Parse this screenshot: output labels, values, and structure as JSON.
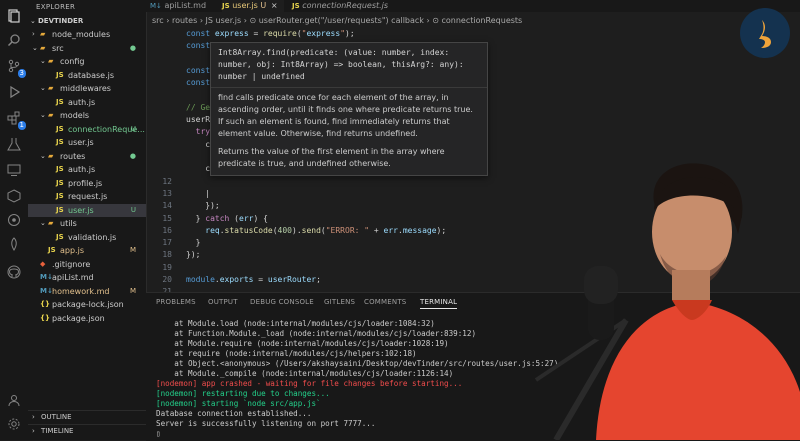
{
  "sidebar": {
    "header": "EXPLORER",
    "project": "DEVTINDER",
    "items": [
      {
        "label": "node_modules",
        "type": "folder",
        "depth": 1,
        "open": false
      },
      {
        "label": "src",
        "type": "folder",
        "depth": 1,
        "open": true,
        "status": "●"
      },
      {
        "label": "config",
        "type": "folder",
        "depth": 2,
        "open": true
      },
      {
        "label": "database.js",
        "type": "js",
        "depth": 3
      },
      {
        "label": "middlewares",
        "type": "folder",
        "depth": 2,
        "open": true
      },
      {
        "label": "auth.js",
        "type": "js",
        "depth": 3
      },
      {
        "label": "models",
        "type": "folder",
        "depth": 2,
        "open": true
      },
      {
        "label": "connectionReque...",
        "type": "js",
        "depth": 3,
        "status": "U"
      },
      {
        "label": "user.js",
        "type": "js",
        "depth": 3
      },
      {
        "label": "routes",
        "type": "folder",
        "depth": 2,
        "open": true,
        "status": "●"
      },
      {
        "label": "auth.js",
        "type": "js",
        "depth": 3
      },
      {
        "label": "profile.js",
        "type": "js",
        "depth": 3
      },
      {
        "label": "request.js",
        "type": "js",
        "depth": 3
      },
      {
        "label": "user.js",
        "type": "js",
        "depth": 3,
        "status": "U",
        "selected": true
      },
      {
        "label": "utils",
        "type": "folder",
        "depth": 2,
        "open": true
      },
      {
        "label": "validation.js",
        "type": "js",
        "depth": 3
      },
      {
        "label": "app.js",
        "type": "js",
        "depth": 2,
        "status": "M"
      },
      {
        "label": ".gitignore",
        "type": "git",
        "depth": 1
      },
      {
        "label": "apiList.md",
        "type": "md",
        "depth": 1
      },
      {
        "label": "homework.md",
        "type": "md",
        "depth": 1,
        "status": "M"
      },
      {
        "label": "package-lock.json",
        "type": "json",
        "depth": 1
      },
      {
        "label": "package.json",
        "type": "json",
        "depth": 1
      }
    ],
    "outline": "OUTLINE",
    "timeline": "TIMELINE"
  },
  "activity_badges": {
    "scm": "3",
    "ext": "1"
  },
  "tabs": [
    {
      "label": "apiList.md",
      "status": "",
      "active": false
    },
    {
      "label": "user.js",
      "status": "U",
      "active": true
    },
    {
      "label": "connectionRequest.js",
      "status": "",
      "active": false
    }
  ],
  "breadcrumb": "src › routes › JS user.js › ⊙ userRouter.get(\"/user/requests\") callback › ⊙ connectionRequests",
  "editor": {
    "lines": [
      {
        "n": "",
        "code": "const express = require(\"express\");"
      },
      {
        "n": "",
        "code": "const"
      },
      {
        "n": "",
        "code": ""
      },
      {
        "n": "",
        "code": "const"
      },
      {
        "n": "",
        "code": "const                                          );"
      },
      {
        "n": "",
        "code": ""
      },
      {
        "n": "",
        "code": "// Get"
      },
      {
        "n": "",
        "code": "userRo                                          {"
      },
      {
        "n": "",
        "code": "  try"
      },
      {
        "n": "",
        "code": "    co"
      },
      {
        "n": "",
        "code": ""
      },
      {
        "n": "",
        "code": "    co"
      },
      {
        "n": "12",
        "code": ""
      },
      {
        "n": "13",
        "code": "    |"
      },
      {
        "n": "14",
        "code": "    });"
      },
      {
        "n": "15",
        "code": "  } catch (err) {"
      },
      {
        "n": "16",
        "code": "    req.statusCode(400).send(\"ERROR: \" + err.message);"
      },
      {
        "n": "17",
        "code": "  }"
      },
      {
        "n": "18",
        "code": "});"
      },
      {
        "n": "19",
        "code": ""
      },
      {
        "n": "20",
        "code": "module.exports = userRouter;"
      },
      {
        "n": "21",
        "code": ""
      }
    ]
  },
  "hover": {
    "signature": "Int8Array.find(predicate: (value: number, index: number, obj: Int8Array) => boolean, thisArg?: any): number | undefined",
    "doc1": "find calls predicate once for each element of the array, in ascending order, until it finds one where predicate returns true. If such an element is found, find immediately returns that element value. Otherwise, find returns undefined.",
    "doc2": "Returns the value of the first element in the array where predicate is true, and undefined otherwise."
  },
  "panel": {
    "tabs": [
      "PROBLEMS",
      "OUTPUT",
      "DEBUG CONSOLE",
      "GITLENS",
      "COMMENTS",
      "TERMINAL"
    ],
    "active_tab": "TERMINAL",
    "terminal": [
      {
        "t": "    at Module.load (node:internal/modules/cjs/loader:1084:32)",
        "c": ""
      },
      {
        "t": "    at Function.Module._load (node:internal/modules/cjs/loader:839:12)",
        "c": ""
      },
      {
        "t": "    at Module.require (node:internal/modules/cjs/loader:1028:19)",
        "c": ""
      },
      {
        "t": "    at require (node:internal/modules/cjs/helpers:102:18)",
        "c": ""
      },
      {
        "t": "    at Object.<anonymous> (/Users/akshaysaini/Desktop/devTinder/src/routes/user.js:5:27)",
        "c": ""
      },
      {
        "t": "    at Module._compile (node:internal/modules/cjs/loader:1126:14)",
        "c": ""
      },
      {
        "t": "[nodemon] app crashed - waiting for file changes before starting...",
        "c": "red"
      },
      {
        "t": "[nodemon] restarting due to changes...",
        "c": "grn"
      },
      {
        "t": "[nodemon] starting `node src/app.js`",
        "c": "grn"
      },
      {
        "t": "Database connection established...",
        "c": ""
      },
      {
        "t": "Server is successfully listening on port 7777...",
        "c": ""
      },
      {
        "t": "▯",
        "c": ""
      }
    ]
  }
}
